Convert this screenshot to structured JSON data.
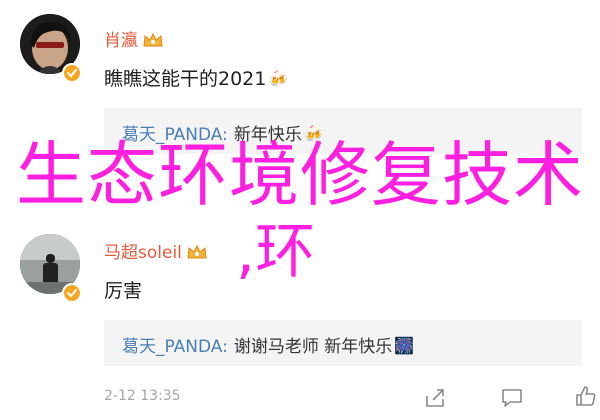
{
  "comments": [
    {
      "username": "肖瀛",
      "text": "瞧瞧这能干的2021",
      "text_emoji": "🍻",
      "reply": {
        "user": "葛天_PANDA",
        "colon": ":",
        "text": "新年快乐",
        "emoji": "🍻"
      }
    },
    {
      "username": "马超soleil",
      "text": "厉害",
      "reply": {
        "user": "葛天_PANDA",
        "colon": ":",
        "text": "谢谢马老师 新年快乐",
        "emoji": "🎆"
      },
      "timestamp": "2-12 13:35"
    }
  ],
  "overlay": {
    "title": "生态环境修复技术",
    "subtitle": ",环"
  },
  "icons": {
    "verify": "verified-badge-icon",
    "crown": "crown-icon",
    "share": "share-icon",
    "comment": "comment-icon",
    "like": "like-icon"
  },
  "colors": {
    "username": "#e35b3e",
    "reply_user": "#4a7fb5",
    "overlay_text": "#ff1fe0",
    "verify_badge": "#f6a623",
    "reply_background": "#f4f4f4"
  }
}
